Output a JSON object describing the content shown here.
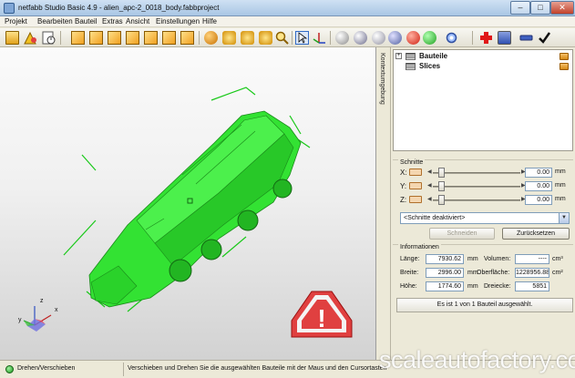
{
  "window": {
    "title": "netfabb Studio Basic 4.9 - alien_apc-2_0018_body.fabbproject",
    "minimize_glyph": "–",
    "maximize_glyph": "□",
    "close_glyph": "✕"
  },
  "menu": [
    "Projekt",
    "Bearbeiten",
    "Bauteil",
    "Extras",
    "Ansicht",
    "Einstellungen",
    "Hilfe"
  ],
  "toolbar": {
    "icons": [
      "open-folder-icon",
      "shapes-icon",
      "history-icon",
      "view-front-icon",
      "view-back-icon",
      "view-left-icon",
      "view-right-icon",
      "view-top-icon",
      "view-bottom-icon",
      "view-perspective-icon",
      "palette-icon",
      "fit-view-icon",
      "zoom-window-icon",
      "zoom-icon",
      "select-cursor-icon",
      "rotate-axes-icon",
      "measure-sphere-icon",
      "shade-sphere-icon",
      "wireframe-icon",
      "texture-icon",
      "color-part-icon",
      "render-icon",
      "settings-icon",
      "repair-cross-icon",
      "apply-repair-icon",
      "minus-icon",
      "checkmark-icon"
    ]
  },
  "viewport": {
    "part_color": "#33e233",
    "selection_color": "#19c919",
    "warning_color": "#e04040",
    "warning_glyph": "!",
    "axis_labels": {
      "x": "x",
      "y": "y",
      "z": "z"
    }
  },
  "side_tab": {
    "label": "Kontextumgebung"
  },
  "tree": {
    "items": [
      {
        "label": "Bauteile",
        "expander": "+"
      },
      {
        "label": "Slices",
        "expander": ""
      }
    ]
  },
  "slices": {
    "title": "Schnitte",
    "rows": [
      {
        "axis": "X:",
        "value": "0.00",
        "unit": "mm"
      },
      {
        "axis": "Y:",
        "value": "0.00",
        "unit": "mm"
      },
      {
        "axis": "Z:",
        "value": "0.00",
        "unit": "mm"
      }
    ],
    "mode_select": "<Schnitte deaktiviert>",
    "cut_button": "Schneiden",
    "reset_button": "Zurücksetzen"
  },
  "info": {
    "title": "Informationen",
    "length_label": "Länge:",
    "length_value": "7930.62",
    "length_unit": "mm",
    "width_label": "Breite:",
    "width_value": "2996.00",
    "width_unit": "mm",
    "height_label": "Höhe:",
    "height_value": "1774.60",
    "height_unit": "mm",
    "volume_label": "Volumen:",
    "volume_value": "----",
    "volume_unit": "cm³",
    "surface_label": "Oberfläche:",
    "surface_value": "1228956.88",
    "surface_unit": "cm²",
    "triangles_label": "Dreiecke:",
    "triangles_value": "5851",
    "selection_msg": "Es ist 1 von 1 Bauteil ausgewählt."
  },
  "statusbar": {
    "mode": "Drehen/Verschieben",
    "hint": "Verschieben und Drehen Sie die ausgewählten Bauteile mit der Maus und den Cursortasten"
  },
  "watermark": "scaleautofactory.com"
}
